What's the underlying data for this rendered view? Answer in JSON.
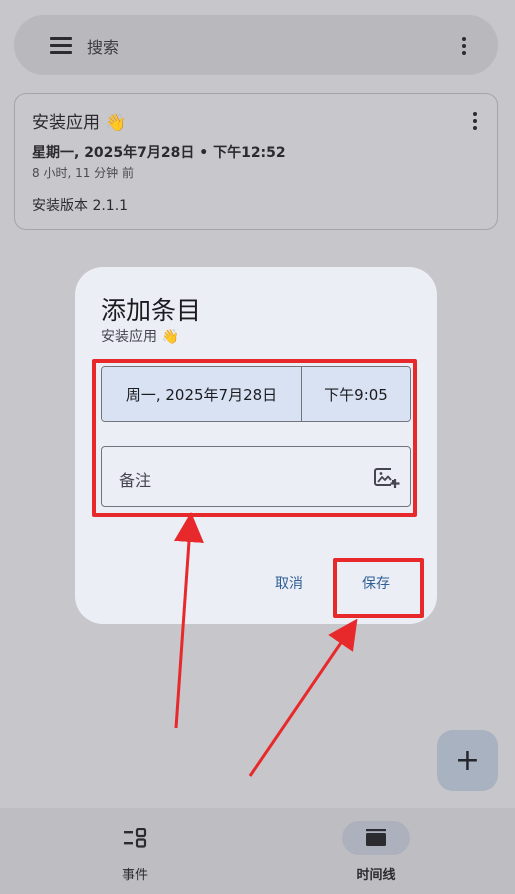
{
  "search_bar": {
    "placeholder": "搜索",
    "menu_icon": "menu-icon",
    "more_icon": "more-vert-icon"
  },
  "entry": {
    "title": "安装应用 👋",
    "datetime": "星期一, 2025年7月28日 • 下午12:52",
    "ago": "8 小时, 11 分钟 前",
    "note": "安装版本 2.1.1"
  },
  "dialog": {
    "title": "添加条目",
    "subtitle": "安装应用 👋",
    "date_value": "周一, 2025年7月28日",
    "time_value": "下午9:05",
    "note_placeholder": "备注",
    "note_icon": "add-photo-icon",
    "cancel_label": "取消",
    "save_label": "保存"
  },
  "fab": {
    "label": "+"
  },
  "bottom_nav": {
    "items": [
      {
        "label": "事件",
        "icon": "events-icon",
        "selected": false
      },
      {
        "label": "时间线",
        "icon": "timeline-icon",
        "selected": true
      }
    ]
  },
  "colors": {
    "annotation_red": "#e8292b",
    "dialog_bg": "#eceef6",
    "accent": "#2f5f95",
    "tonal": "#d9e2f3"
  }
}
